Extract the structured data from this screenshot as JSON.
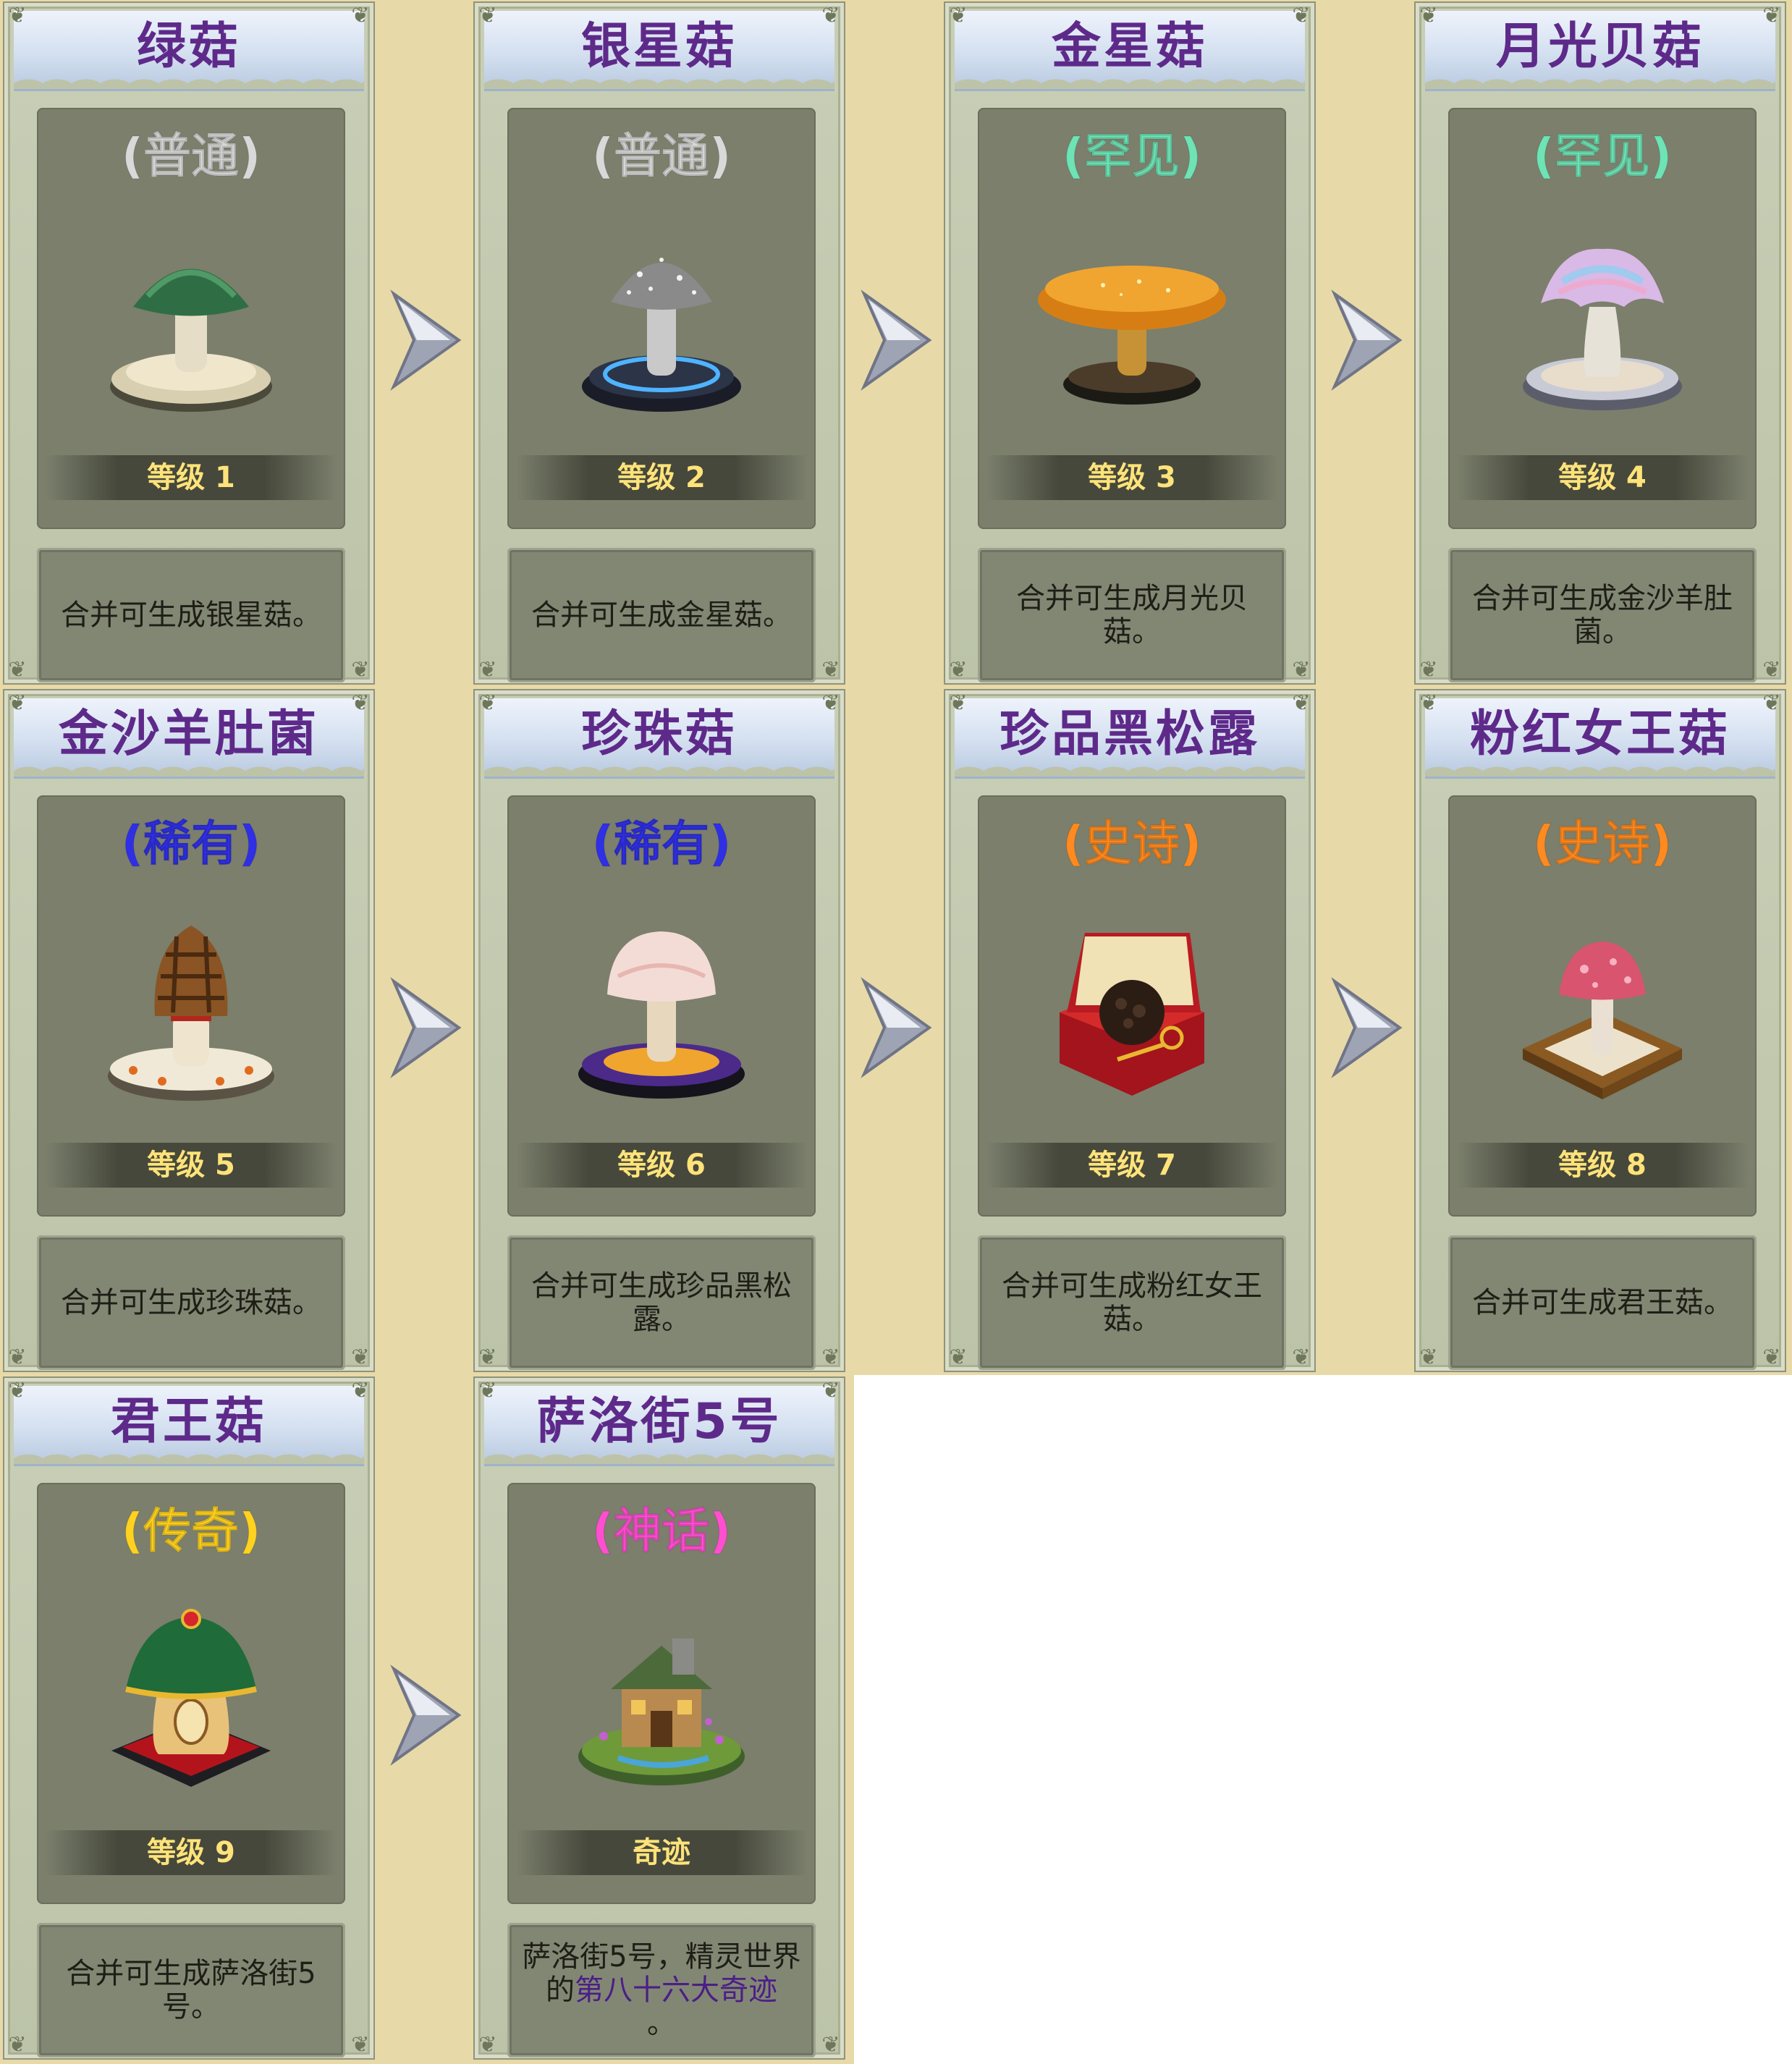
{
  "items": [
    {
      "name": "绿菇",
      "rarity": "(普通)",
      "rarity_color": "#d9d9d9",
      "level": "等级 1",
      "desc": "合并可生成银星菇。",
      "art": "green-mushroom-icon"
    },
    {
      "name": "银星菇",
      "rarity": "(普通)",
      "rarity_color": "#d9d9d9",
      "level": "等级 2",
      "desc": "合并可生成金星菇。",
      "art": "silver-star-mushroom-icon"
    },
    {
      "name": "金星菇",
      "rarity": "(罕见)",
      "rarity_color": "#6ee3b5",
      "level": "等级 3",
      "desc": "合并可生成月光贝菇。",
      "art": "gold-star-mushroom-icon"
    },
    {
      "name": "月光贝菇",
      "rarity": "(罕见)",
      "rarity_color": "#6ee3b5",
      "level": "等级 4",
      "desc": "合并可生成金沙羊肚菌。",
      "art": "moonlight-shell-mushroom-icon"
    },
    {
      "name": "金沙羊肚菌",
      "rarity": "(稀有)",
      "rarity_color": "#2f2fe6",
      "level": "等级 5",
      "desc": "合并可生成珍珠菇。",
      "art": "morel-mushroom-icon"
    },
    {
      "name": "珍珠菇",
      "rarity": "(稀有)",
      "rarity_color": "#2f2fe6",
      "level": "等级 6",
      "desc": "合并可生成珍品黑松露。",
      "art": "pearl-mushroom-icon"
    },
    {
      "name": "珍品黑松露",
      "rarity": "(史诗)",
      "rarity_color": "#ff8a1f",
      "level": "等级 7",
      "desc": "合并可生成粉红女王菇。",
      "art": "black-truffle-icon"
    },
    {
      "name": "粉红女王菇",
      "rarity": "(史诗)",
      "rarity_color": "#ff8a1f",
      "level": "等级 8",
      "desc": "合并可生成君王菇。",
      "art": "pink-queen-mushroom-icon"
    },
    {
      "name": "君王菇",
      "rarity": "(传奇)",
      "rarity_color": "#ffd21f",
      "level": "等级 9",
      "desc": "合并可生成萨洛街5号。",
      "art": "king-mushroom-icon"
    },
    {
      "name": "萨洛街5号",
      "rarity": "(神话)",
      "rarity_color": "#ff4fd0",
      "level": "奇迹",
      "desc_a": "萨洛街5号，精灵世界的",
      "desc_b": "第八十六大奇迹",
      "desc_c": "。",
      "art": "mushroom-cottage-icon"
    }
  ]
}
